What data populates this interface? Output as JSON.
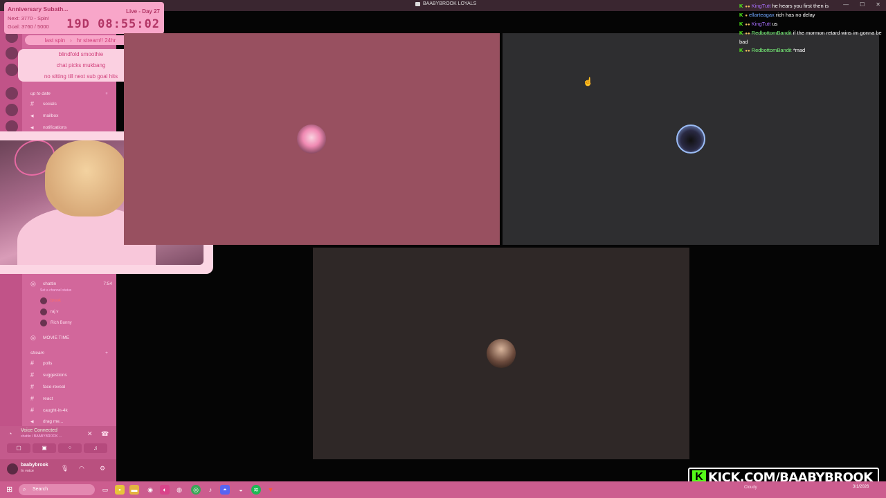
{
  "window": {
    "title": "BAABYBROOK LOYALS"
  },
  "subathon": {
    "title": "Anniversary Subath...",
    "next": "Next: 3770 - Spin!",
    "goal": "Goal: 3760 / 5000",
    "live_day": "Live - Day 27",
    "timer": "19D 08:55:02"
  },
  "spin_bar": {
    "left": "last spin",
    "right": "hr stream!! 24hr"
  },
  "wheel": {
    "options": [
      "blindfold smoothie",
      "chat picks mukbang",
      "no sitting till next sub goal hits"
    ]
  },
  "sidebar": {
    "categories": {
      "up_to_date": "up to date",
      "stream": "stream"
    },
    "channels_top": [
      "socials",
      "mailbox",
      "notifications"
    ],
    "voice_channel": {
      "name": "chattin",
      "time": "7:54",
      "status": "Set a channel status"
    },
    "voice_users": [
      "brook",
      "raj v",
      "Rich Bunny"
    ],
    "movie_time": "MOVIE TIME",
    "stream_channels": [
      "polls",
      "suggestions",
      "face-reveal",
      "react",
      "caught-in-4k",
      "drag me..."
    ]
  },
  "voice_panel": {
    "title": "Voice Connected",
    "sub": "chattin / BAABYBROOK ..."
  },
  "user_panel": {
    "name": "baabybrook",
    "status": "In voice"
  },
  "chat": [
    {
      "user": "KingTutt",
      "color": "purple",
      "text": "he hears you first then is"
    },
    {
      "user": "ellarteagax",
      "color": "blue",
      "text": "rich has no delay"
    },
    {
      "user": "KingTutt",
      "color": "purple",
      "text": "us"
    },
    {
      "user": "RedbottomBandit",
      "color": "green",
      "text": "if the mormon retard wins im gonna be bad"
    },
    {
      "user": "RedbottomBandit",
      "color": "green",
      "text": "*mad"
    }
  ],
  "brand": {
    "text": "KICK.COM/BAABYBROOK"
  },
  "taskbar": {
    "search_placeholder": "Search",
    "weather": "Cloudy",
    "date": "3/1/2026"
  },
  "colors": {
    "accent": "#d2679b",
    "kick_green": "#53fc18",
    "pink_tile": "#985060"
  }
}
